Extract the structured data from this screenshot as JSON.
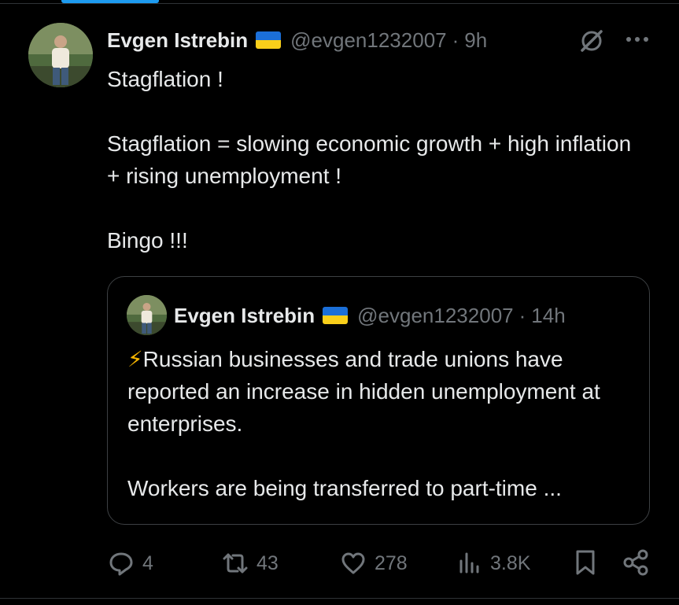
{
  "post": {
    "author_name": "Evgen Istrebin",
    "handle": "@evgen1232007",
    "separator": "·",
    "time": "9h",
    "text": "Stagflation !\n\nStagflation = slowing economic growth + high inflation + rising unemployment !\n\nBingo !!!"
  },
  "quote": {
    "author_name": "Evgen Istrebin",
    "handle": "@evgen1232007",
    "separator": "·",
    "time": "14h",
    "bolt": "⚡",
    "text": "Russian businesses and trade unions have reported an increase in hidden unemployment at enterprises.\n\nWorkers are being transferred to part-time ..."
  },
  "actions": {
    "replies": "4",
    "reposts": "43",
    "likes": "278",
    "views": "3.8K"
  },
  "icons": [
    "grok-icon",
    "more-icon",
    "reply-icon",
    "repost-icon",
    "like-icon",
    "views-icon",
    "bookmark-icon",
    "share-icon",
    "ukraine-flag-icon"
  ],
  "colors": {
    "background": "#000000",
    "text": "#e7e9ea",
    "secondary": "#71767b",
    "accent": "#1d9bf0",
    "flag_blue": "#1b6fd8",
    "flag_yellow": "#f9cf1a"
  }
}
